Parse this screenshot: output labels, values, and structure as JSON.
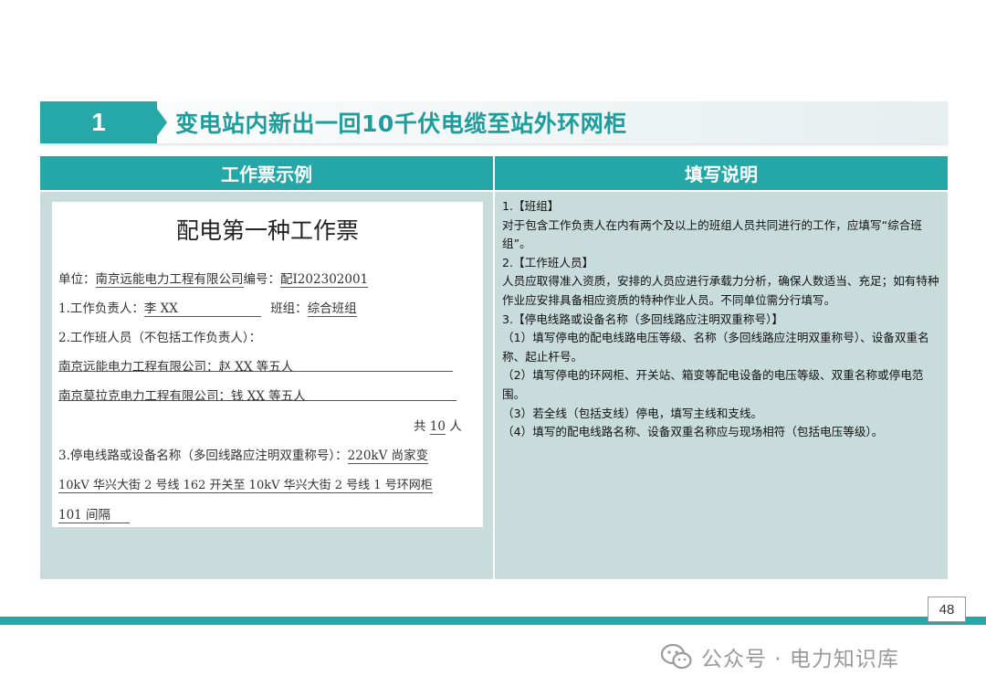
{
  "section": {
    "number": "1",
    "title": "变电站内新出一回10千伏电缆至站外环网柜"
  },
  "table": {
    "header_left": "工作票示例",
    "header_right": "填写说明"
  },
  "ticket": {
    "title": "配电第一种工作票",
    "unit_label": "单位：",
    "unit_value": "南京远能电力工程有限公司",
    "no_label": "编号：",
    "no_value": "配I202302001",
    "leader_label": "1.工作负责人：",
    "leader_value": "李 XX",
    "team_label": "班组：",
    "team_value": "综合班组",
    "members_label": "2.工作班人员（不包括工作负责人）：",
    "member_line_1": "南京远能电力工程有限公司：赵 XX 等五人",
    "member_line_2": "南京莫拉克电力工程有限公司：钱 XX 等五人",
    "total_prefix": "共",
    "total_value": "10",
    "total_suffix": "人",
    "line3_label": "3.停电线路或设备名称（多回线路应注明双重称号）：",
    "line3_value_1": "220kV 尚家变",
    "line3_value_2": "10kV 华兴大街 2 号线 162 开关至 10kV 华兴大街 2 号线 1 号环网柜",
    "line3_value_3": "101 间隔"
  },
  "desc": {
    "lines": [
      "1.【班组】",
      "对于包含工作负责人在内有两个及以上的班组人员共同进行的工作，应填写“综合班组”。",
      "2.【工作班人员】",
      "人员应取得准入资质，安排的人员应进行承载力分析，确保人数适当、充足；如有特种作业应安排具备相应资质的特种作业人员。不同单位需分行填写。",
      "3.【停电线路或设备名称（多回线路应注明双重称号）】",
      "（1）填写停电的配电线路电压等级、名称（多回线路应注明双重称号）、设备双重名称、起止杆号。",
      "（2）填写停电的环网柜、开关站、箱变等配电设备的电压等级、双重名称或停电范围。",
      "（3）若全线（包括支线）停电，填写主线和支线。",
      "（4）填写的配电线路名称、设备双重名称应与现场相符（包括电压等级）。"
    ]
  },
  "footer": {
    "page_number": "48",
    "watermark": "公众号 · 电力知识库",
    "watermark_icon": "wechat-icon"
  },
  "colors": {
    "accent": "#27a8a8",
    "title_text": "#1e9d9d",
    "cell_bg": "#c9dcdc"
  }
}
